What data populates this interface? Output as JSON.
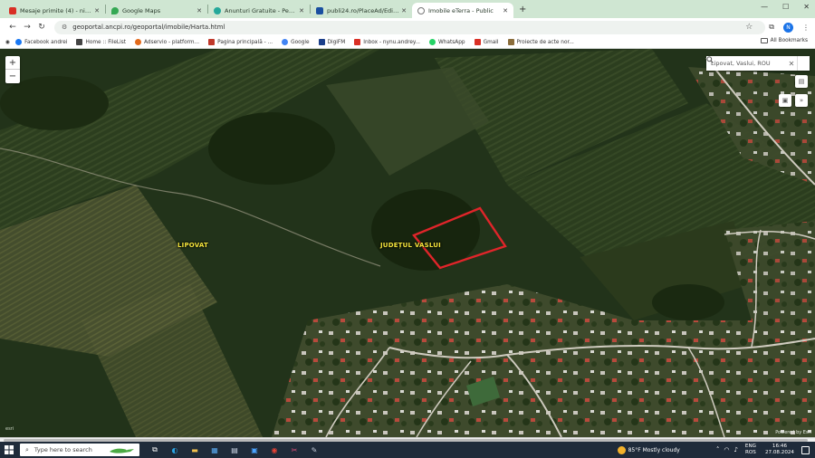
{
  "tabs": [
    {
      "title": "Mesaje primite (4) - ninu.mobile@...",
      "favicon_color": "#d93025",
      "active": false
    },
    {
      "title": "Google Maps",
      "favicon_color": "#34a853",
      "active": false
    },
    {
      "title": "Anunturi Gratuite - Peste 4 milio...",
      "favicon_color": "#23a89a",
      "active": false
    },
    {
      "title": "publi24.ro/PlaceAd/EditSuccess...",
      "favicon_color": "#1a4fa0",
      "active": false
    },
    {
      "title": "Imobile eTerra - Public",
      "favicon_color": "#777777",
      "active": true
    }
  ],
  "new_tab_symbol": "+",
  "window_controls": {
    "minimize": "—",
    "maximize": "☐",
    "close": "✕"
  },
  "address_bar": {
    "url": "geoportal.ancpi.ro/geoportal/imobile/Harta.html"
  },
  "nav": {
    "back": "←",
    "forward": "→",
    "reload": "↻"
  },
  "profile_initial": "N",
  "bookmarks": [
    {
      "label": "Facebook andrei",
      "color": "#1877f2"
    },
    {
      "label": "Home :: FileList",
      "color": "#444444"
    },
    {
      "label": "Adservio - platform...",
      "color": "#e26a1b"
    },
    {
      "label": "Pagina principală - ...",
      "color": "#c0392b"
    },
    {
      "label": "Google",
      "color": "#4285f4"
    },
    {
      "label": "DigiFM",
      "color": "#1b3f8a"
    },
    {
      "label": "Inbox - nynu.andrey...",
      "color": "#d93025"
    },
    {
      "label": "WhatsApp",
      "color": "#25d366"
    },
    {
      "label": "Gmail",
      "color": "#d93025"
    },
    {
      "label": "Proiecte de acte nor...",
      "color": "#8a6d3b"
    }
  ],
  "all_bookmarks_label": "All Bookmarks",
  "map": {
    "zoom_in": "+",
    "zoom_out": "−",
    "search_value": "Lipovat, Vaslui, ROU",
    "clear_symbol": "✕",
    "place_label_1": "LIPOVAT",
    "place_label_2": "JUDEȚUL VASLUI",
    "attribution_left": "esri",
    "attribution_right": "Powered by Esri",
    "parcel_color": "#e0252a"
  },
  "taskbar": {
    "search_placeholder": "Type here to search",
    "weather": "85°F  Mostly cloudy",
    "lang_top": "ENG",
    "lang_bottom": "ROS",
    "time": "16:46",
    "date": "27.08.2024"
  }
}
